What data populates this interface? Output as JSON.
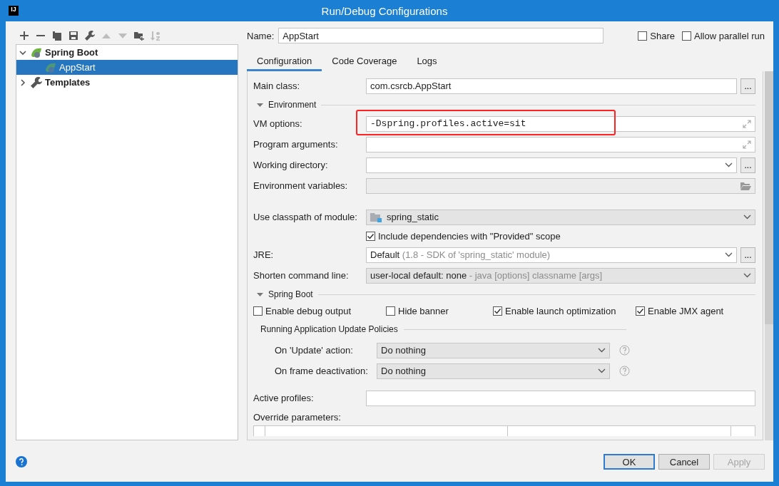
{
  "window": {
    "title": "Run/Debug Configurations",
    "app_icon": "IJ"
  },
  "toolbar": [
    {
      "kind": "add",
      "disabled": false
    },
    {
      "kind": "remove",
      "disabled": false
    },
    {
      "kind": "copy",
      "disabled": false
    },
    {
      "kind": "save",
      "disabled": false
    },
    {
      "kind": "wrench",
      "disabled": false
    },
    {
      "kind": "up",
      "disabled": true
    },
    {
      "kind": "down",
      "disabled": true
    },
    {
      "kind": "folder",
      "disabled": false
    },
    {
      "kind": "sort",
      "disabled": true
    }
  ],
  "tree": [
    {
      "label": "Spring Boot",
      "kind": "spring",
      "expanded": true,
      "selected": false,
      "children": [
        {
          "label": "AppStart",
          "kind": "spring",
          "selected": true
        }
      ]
    },
    {
      "label": "Templates",
      "kind": "wrench",
      "expanded": false,
      "selected": false
    }
  ],
  "name": {
    "label": "Name:",
    "value": "AppStart"
  },
  "options": [
    {
      "label": "Share",
      "checked": false
    },
    {
      "label": "Allow parallel run",
      "checked": false
    }
  ],
  "tabs": [
    {
      "label": "Configuration",
      "selected": true
    },
    {
      "label": "Code Coverage",
      "selected": false
    },
    {
      "label": "Logs",
      "selected": false
    }
  ],
  "main_class": {
    "label": "Main class:",
    "value": "com.csrcb.AppStart",
    "button": "..."
  },
  "environment": {
    "title": "Environment",
    "expanded": true,
    "fields": [
      {
        "kind": "expand",
        "label": "VM options:",
        "value": "-Dspring.profiles.active=sit",
        "highlighted": true,
        "disabled": false
      },
      {
        "kind": "expand",
        "label": "Program arguments:",
        "highlighted": false,
        "disabled": false
      },
      {
        "kind": "combo-browse",
        "label": "Working directory:",
        "button": "...",
        "highlighted": false,
        "disabled": false
      },
      {
        "kind": "folder",
        "label": "Environment variables:",
        "highlighted": false,
        "disabled": true
      }
    ]
  },
  "module": {
    "label": "Use classpath of module:",
    "value": "spring_static"
  },
  "include_provided": {
    "label": "Include dependencies with \"Provided\" scope",
    "checked": true
  },
  "jre": {
    "label": "JRE:",
    "value": "Default",
    "hint": "(1.8 - SDK of 'spring_static' module)",
    "button": "..."
  },
  "shorten": {
    "label": "Shorten command line:",
    "value": "user-local default: none",
    "hint": "- java [options] classname [args]"
  },
  "spring_boot": {
    "title": "Spring Boot",
    "expanded": true,
    "options": [
      {
        "label": "Enable debug output",
        "checked": false
      },
      {
        "label": "Hide banner",
        "checked": false
      },
      {
        "label": "Enable launch optimization",
        "checked": true
      },
      {
        "label": "Enable JMX agent",
        "checked": true
      }
    ],
    "policies": {
      "title": "Running Application Update Policies",
      "rows": [
        {
          "label": "On 'Update' action:",
          "value": "Do nothing"
        },
        {
          "label": "On frame deactivation:",
          "value": "Do nothing"
        }
      ]
    }
  },
  "active_profiles": {
    "label": "Active profiles:"
  },
  "override": {
    "label": "Override parameters:"
  },
  "buttons": [
    {
      "label": "OK",
      "kind": "default",
      "disabled": false
    },
    {
      "label": "Cancel",
      "kind": "normal",
      "disabled": false
    },
    {
      "label": "Apply",
      "kind": "normal",
      "disabled": true
    }
  ]
}
